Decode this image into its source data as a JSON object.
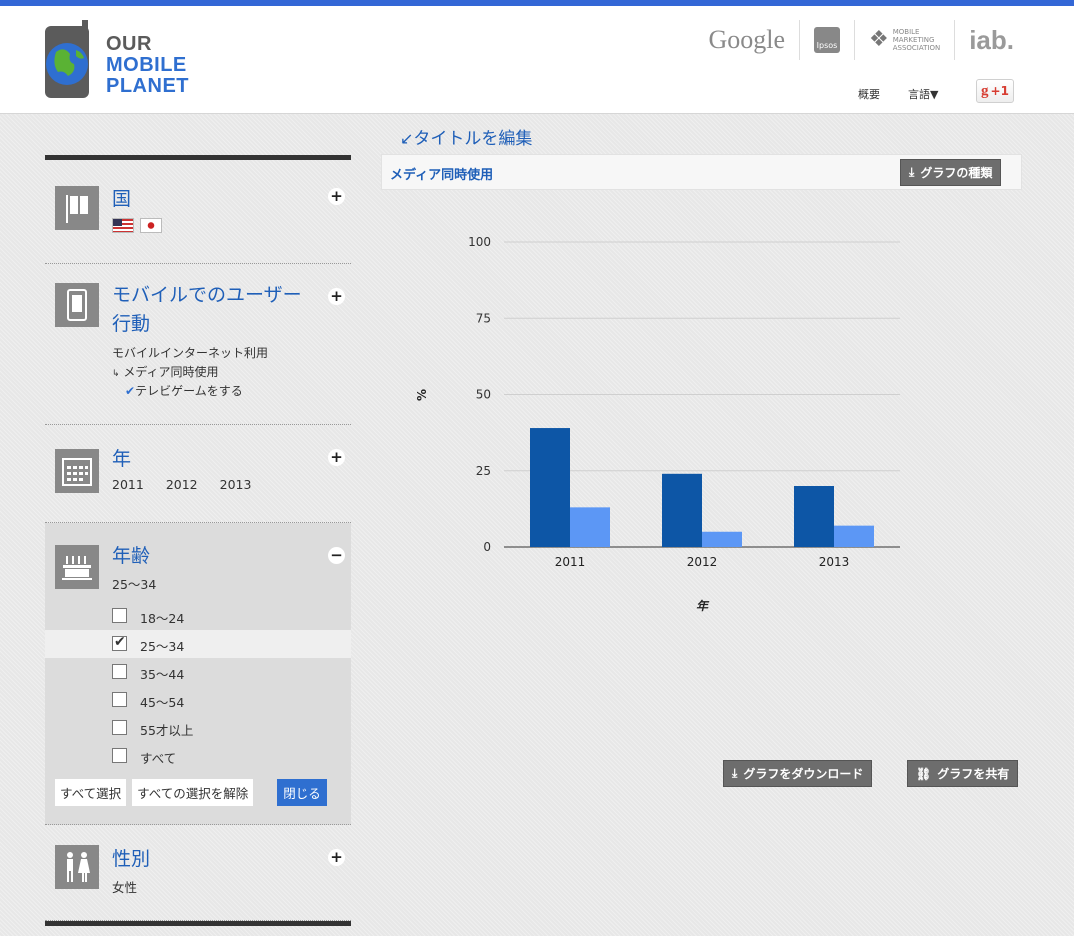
{
  "header": {
    "logo_line1": "OUR",
    "logo_line2": "MOBILE",
    "logo_line3": "PLANET",
    "partners": {
      "google": "Google",
      "ipsos": "Ipsos",
      "mma_line1": "MOBILE",
      "mma_line2": "MARKETING",
      "mma_line3": "ASSOCIATION",
      "iab": "iab."
    },
    "link_overview": "概要",
    "link_language": "言語▼",
    "gplus": "+1"
  },
  "sidebar": {
    "country": {
      "title": "国"
    },
    "behavior": {
      "title_line1": "モバイルでのユーザー",
      "title_line2": "行動",
      "line1": "モバイルインターネット利用",
      "line2": "メディア同時使用",
      "line3": "テレビゲームをする"
    },
    "year": {
      "title": "年",
      "values": [
        "2011",
        "2012",
        "2013"
      ]
    },
    "age": {
      "title": "年齢",
      "selected": "25〜34",
      "options": [
        "18〜24",
        "25〜34",
        "35〜44",
        "45〜54",
        "55才以上",
        "すべて"
      ],
      "checked_index": 1,
      "select_all": "すべて選択",
      "deselect_all": "すべての選択を解除",
      "close": "閉じる"
    },
    "gender": {
      "title": "性別",
      "selected": "女性"
    }
  },
  "main": {
    "edit_title": "タイトルを編集",
    "chart_title": "メディア同時使用",
    "graph_type_button": "グラフの種類",
    "download_button": "グラフをダウンロード",
    "share_button": "グラフを共有"
  },
  "colors": {
    "series1": "#0d56a6",
    "series2": "#5c97f5",
    "accent": "#2f6fd0"
  },
  "chart_data": {
    "type": "bar",
    "categories": [
      "2011",
      "2012",
      "2013"
    ],
    "series": [
      {
        "values": [
          39,
          24,
          20
        ]
      },
      {
        "values": [
          13,
          5,
          7
        ]
      }
    ],
    "xlabel": "年",
    "ylabel": "%",
    "ylim": [
      0,
      100
    ],
    "yticks": [
      0,
      25,
      50,
      75,
      100
    ],
    "grid": true
  }
}
